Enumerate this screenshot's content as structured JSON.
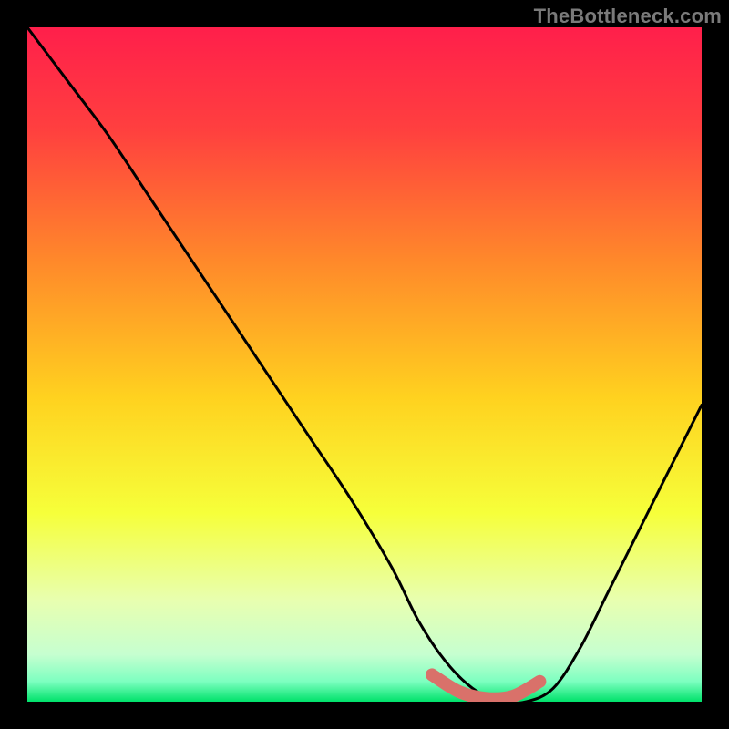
{
  "watermark": "TheBottleneck.com",
  "chart_data": {
    "type": "line",
    "title": "",
    "xlabel": "",
    "ylabel": "",
    "xlim": [
      0,
      100
    ],
    "ylim": [
      0,
      100
    ],
    "grid": false,
    "legend": false,
    "gradient_stops": [
      {
        "offset": 0.0,
        "color": "#ff1f4b"
      },
      {
        "offset": 0.15,
        "color": "#ff3f3f"
      },
      {
        "offset": 0.35,
        "color": "#ff8a2a"
      },
      {
        "offset": 0.55,
        "color": "#ffd21f"
      },
      {
        "offset": 0.72,
        "color": "#f6ff3a"
      },
      {
        "offset": 0.85,
        "color": "#e8ffb0"
      },
      {
        "offset": 0.93,
        "color": "#c6ffd0"
      },
      {
        "offset": 0.97,
        "color": "#7dffc0"
      },
      {
        "offset": 1.0,
        "color": "#00e26b"
      }
    ],
    "series": [
      {
        "name": "bottleneck-curve",
        "x": [
          0,
          6,
          12,
          18,
          24,
          30,
          36,
          42,
          48,
          54,
          58,
          62,
          66,
          70,
          74,
          78,
          82,
          86,
          90,
          94,
          100
        ],
        "y": [
          100,
          92,
          84,
          75,
          66,
          57,
          48,
          39,
          30,
          20,
          12,
          6,
          2,
          0,
          0,
          2,
          8,
          16,
          24,
          32,
          44
        ]
      }
    ],
    "highlight_segment": {
      "name": "lowest-bottleneck-band",
      "x": [
        60,
        64,
        68,
        72,
        76
      ],
      "y": [
        4,
        1.5,
        0.5,
        0.8,
        3
      ],
      "color": "#d9716a",
      "width": 14
    }
  }
}
